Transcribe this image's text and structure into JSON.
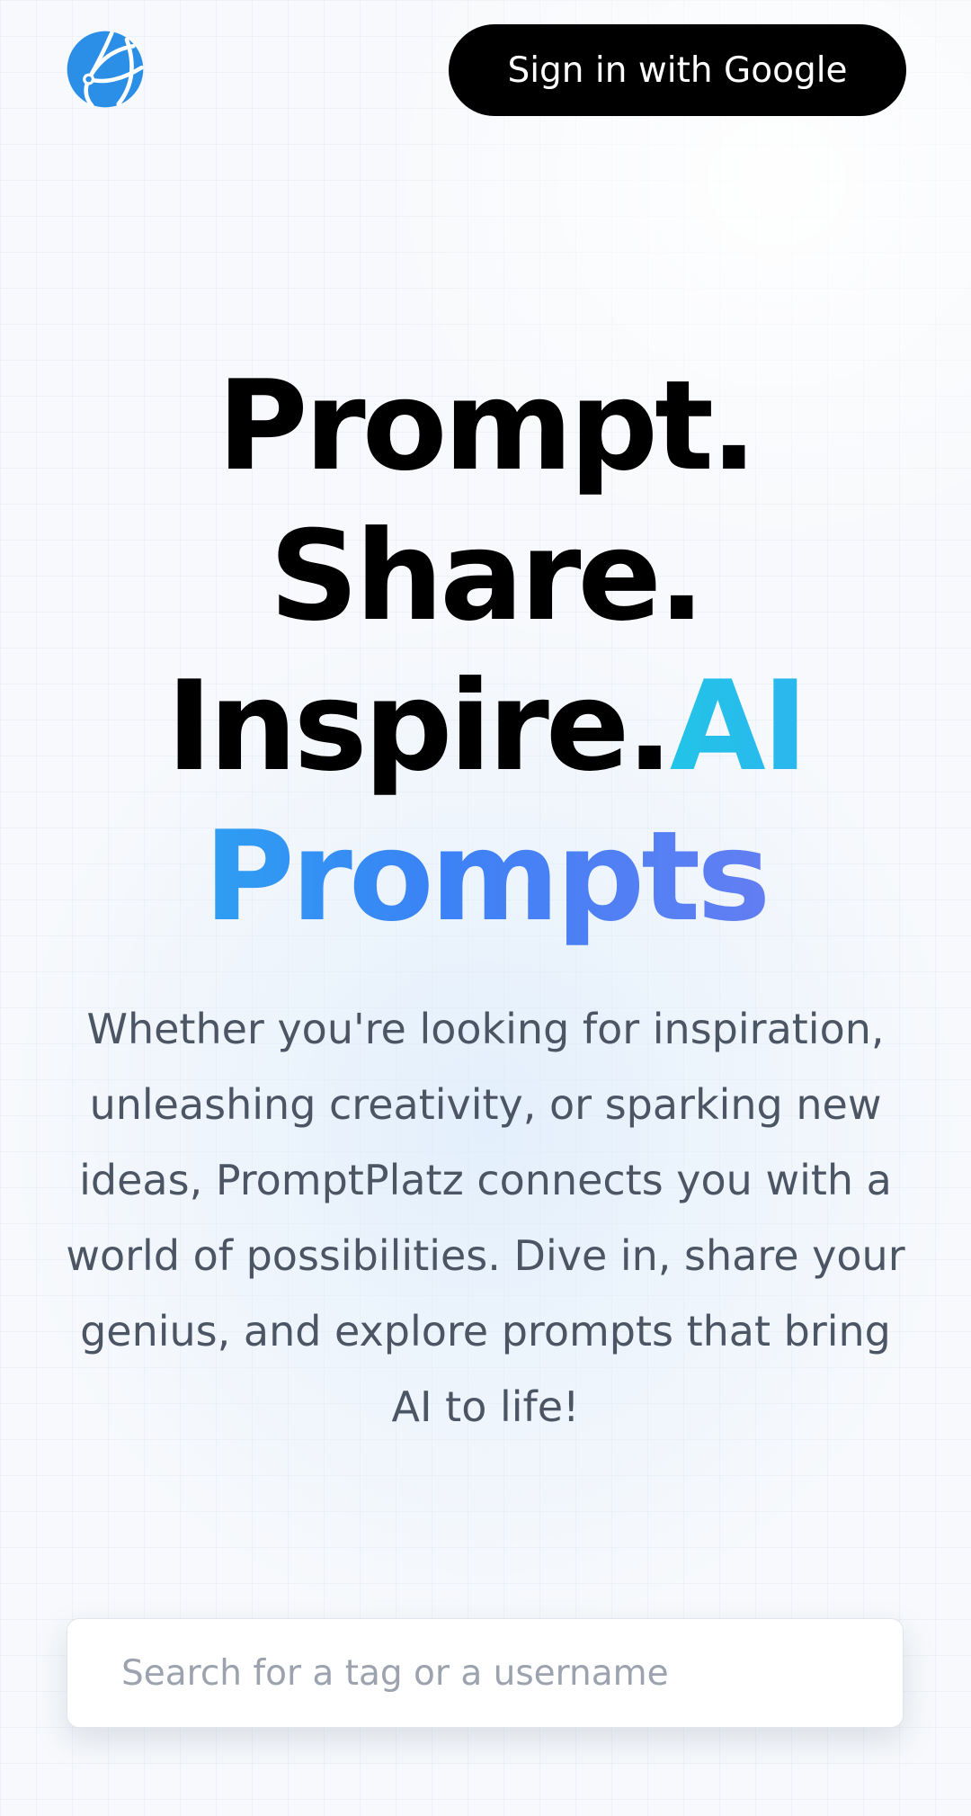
{
  "header": {
    "logo_icon": "globe-network-icon",
    "signin_label": "Sign in with Google"
  },
  "hero": {
    "line1": "Prompt.",
    "line2": "Share.",
    "line3": "Inspire.",
    "accent_word1": "AI",
    "accent_word2": "Prompts"
  },
  "description": "Whether you're looking for inspiration, unleashing creativity, or sparking new ideas, PromptPlatz connects you with a world of possibilities. Dive in, share your genius, and explore prompts that bring AI to life!",
  "search": {
    "placeholder": "Search for a tag or a username",
    "value": ""
  },
  "colors": {
    "brand_blue": "#2b8fe8",
    "accent_cyan": "#22c4e8",
    "accent_blue": "#3b82f6",
    "accent_violet": "#7b7cf0",
    "button_bg": "#000000",
    "body_text": "#4b5563"
  }
}
